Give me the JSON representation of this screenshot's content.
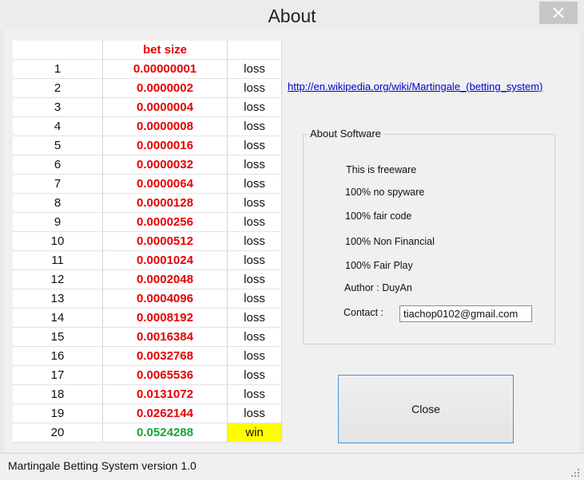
{
  "window": {
    "title": "About"
  },
  "table": {
    "header_bet_size": "bet size",
    "rows": [
      {
        "n": "1",
        "size": "0.00000001",
        "result": "loss"
      },
      {
        "n": "2",
        "size": "0.0000002",
        "result": "loss"
      },
      {
        "n": "3",
        "size": "0.0000004",
        "result": "loss"
      },
      {
        "n": "4",
        "size": "0.0000008",
        "result": "loss"
      },
      {
        "n": "5",
        "size": "0.0000016",
        "result": "loss"
      },
      {
        "n": "6",
        "size": "0.0000032",
        "result": "loss"
      },
      {
        "n": "7",
        "size": "0.0000064",
        "result": "loss"
      },
      {
        "n": "8",
        "size": "0.0000128",
        "result": "loss"
      },
      {
        "n": "9",
        "size": "0.0000256",
        "result": "loss"
      },
      {
        "n": "10",
        "size": "0.0000512",
        "result": "loss"
      },
      {
        "n": "11",
        "size": "0.0001024",
        "result": "loss"
      },
      {
        "n": "12",
        "size": "0.0002048",
        "result": "loss"
      },
      {
        "n": "13",
        "size": "0.0004096",
        "result": "loss"
      },
      {
        "n": "14",
        "size": "0.0008192",
        "result": "loss"
      },
      {
        "n": "15",
        "size": "0.0016384",
        "result": "loss"
      },
      {
        "n": "16",
        "size": "0.0032768",
        "result": "loss"
      },
      {
        "n": "17",
        "size": "0.0065536",
        "result": "loss"
      },
      {
        "n": "18",
        "size": "0.0131072",
        "result": "loss"
      },
      {
        "n": "19",
        "size": "0.0262144",
        "result": "loss"
      },
      {
        "n": "20",
        "size": "0.0524288",
        "result": "win"
      }
    ]
  },
  "link": "http://en.wikipedia.org/wiki/Martingale_(betting_system)",
  "about": {
    "group_title": "About Software",
    "freeware": "This is freeware",
    "spyware": "100% no spyware",
    "fair_code": "100% fair code",
    "non_financial": "100% Non Financial",
    "fair_play": "100% Fair Play",
    "author": "Author : DuyAn",
    "contact_label": "Contact :",
    "contact_value": "tiachop0102@gmail.com"
  },
  "buttons": {
    "close": "Close"
  },
  "status": "Martingale Betting System version 1.0",
  "colors": {
    "bet_size": "#e60000",
    "win_size": "#17a33a",
    "win_bg": "#ffff00",
    "link": "#0000cc"
  },
  "icons": {
    "window_close": "close-icon",
    "resize": "resize-grip-icon"
  }
}
